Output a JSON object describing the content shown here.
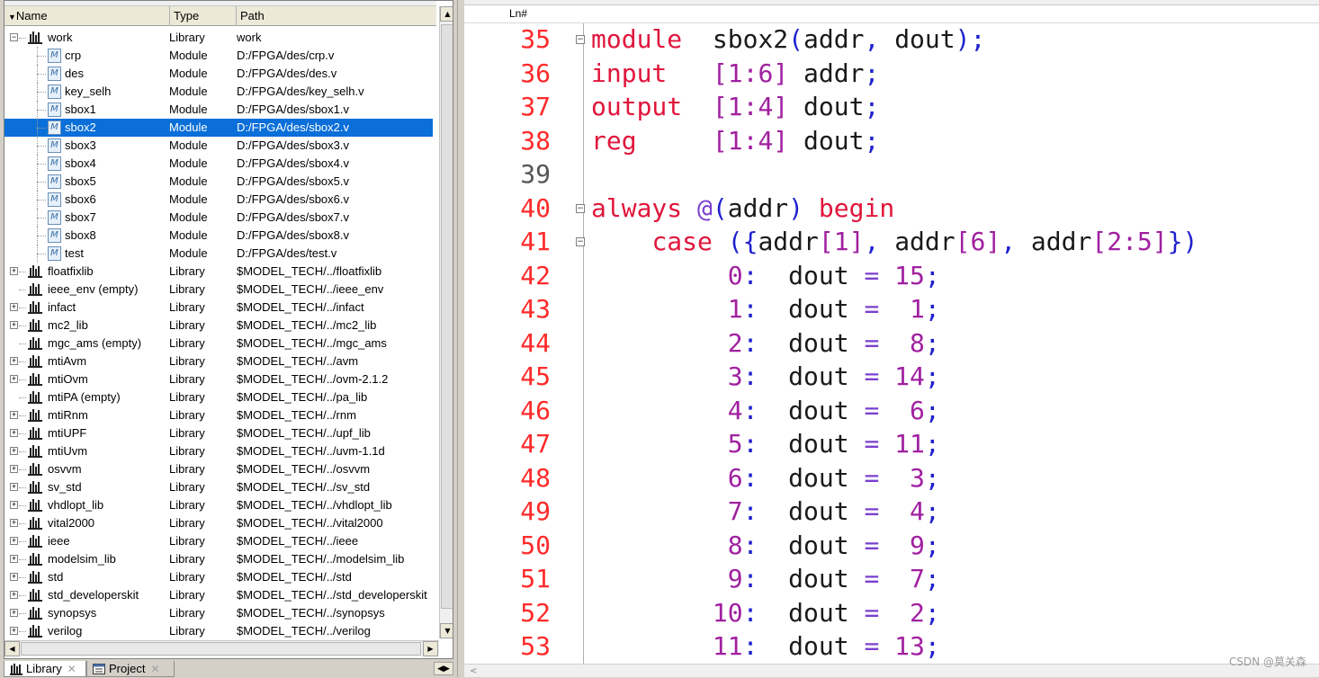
{
  "library": {
    "columns": {
      "name": "Name",
      "type": "Type",
      "path": "Path"
    },
    "rows": [
      {
        "name": "work",
        "type": "Library",
        "path": "work",
        "kind": "lib",
        "expander": "−",
        "level": 0
      },
      {
        "name": "crp",
        "type": "Module",
        "path": "D:/FPGA/des/crp.v",
        "kind": "mod",
        "level": 1
      },
      {
        "name": "des",
        "type": "Module",
        "path": "D:/FPGA/des/des.v",
        "kind": "mod",
        "level": 1
      },
      {
        "name": "key_selh",
        "type": "Module",
        "path": "D:/FPGA/des/key_selh.v",
        "kind": "mod",
        "level": 1
      },
      {
        "name": "sbox1",
        "type": "Module",
        "path": "D:/FPGA/des/sbox1.v",
        "kind": "mod",
        "level": 1
      },
      {
        "name": "sbox2",
        "type": "Module",
        "path": "D:/FPGA/des/sbox2.v",
        "kind": "mod",
        "level": 1,
        "selected": true
      },
      {
        "name": "sbox3",
        "type": "Module",
        "path": "D:/FPGA/des/sbox3.v",
        "kind": "mod",
        "level": 1
      },
      {
        "name": "sbox4",
        "type": "Module",
        "path": "D:/FPGA/des/sbox4.v",
        "kind": "mod",
        "level": 1
      },
      {
        "name": "sbox5",
        "type": "Module",
        "path": "D:/FPGA/des/sbox5.v",
        "kind": "mod",
        "level": 1
      },
      {
        "name": "sbox6",
        "type": "Module",
        "path": "D:/FPGA/des/sbox6.v",
        "kind": "mod",
        "level": 1
      },
      {
        "name": "sbox7",
        "type": "Module",
        "path": "D:/FPGA/des/sbox7.v",
        "kind": "mod",
        "level": 1
      },
      {
        "name": "sbox8",
        "type": "Module",
        "path": "D:/FPGA/des/sbox8.v",
        "kind": "mod",
        "level": 1
      },
      {
        "name": "test",
        "type": "Module",
        "path": "D:/FPGA/des/test.v",
        "kind": "mod",
        "level": 1
      },
      {
        "name": "floatfixlib",
        "type": "Library",
        "path": "$MODEL_TECH/../floatfixlib",
        "kind": "lib",
        "expander": "+",
        "level": 0
      },
      {
        "name": "ieee_env  (empty)",
        "type": "Library",
        "path": "$MODEL_TECH/../ieee_env",
        "kind": "lib",
        "level": 0
      },
      {
        "name": "infact",
        "type": "Library",
        "path": "$MODEL_TECH/../infact",
        "kind": "lib",
        "expander": "+",
        "level": 0
      },
      {
        "name": "mc2_lib",
        "type": "Library",
        "path": "$MODEL_TECH/../mc2_lib",
        "kind": "lib",
        "expander": "+",
        "level": 0
      },
      {
        "name": "mgc_ams  (empty)",
        "type": "Library",
        "path": "$MODEL_TECH/../mgc_ams",
        "kind": "lib",
        "level": 0
      },
      {
        "name": "mtiAvm",
        "type": "Library",
        "path": "$MODEL_TECH/../avm",
        "kind": "lib",
        "expander": "+",
        "level": 0
      },
      {
        "name": "mtiOvm",
        "type": "Library",
        "path": "$MODEL_TECH/../ovm-2.1.2",
        "kind": "lib",
        "expander": "+",
        "level": 0
      },
      {
        "name": "mtiPA  (empty)",
        "type": "Library",
        "path": "$MODEL_TECH/../pa_lib",
        "kind": "lib",
        "level": 0
      },
      {
        "name": "mtiRnm",
        "type": "Library",
        "path": "$MODEL_TECH/../rnm",
        "kind": "lib",
        "expander": "+",
        "level": 0
      },
      {
        "name": "mtiUPF",
        "type": "Library",
        "path": "$MODEL_TECH/../upf_lib",
        "kind": "lib",
        "expander": "+",
        "level": 0
      },
      {
        "name": "mtiUvm",
        "type": "Library",
        "path": "$MODEL_TECH/../uvm-1.1d",
        "kind": "lib",
        "expander": "+",
        "level": 0
      },
      {
        "name": "osvvm",
        "type": "Library",
        "path": "$MODEL_TECH/../osvvm",
        "kind": "lib",
        "expander": "+",
        "level": 0
      },
      {
        "name": "sv_std",
        "type": "Library",
        "path": "$MODEL_TECH/../sv_std",
        "kind": "lib",
        "expander": "+",
        "level": 0
      },
      {
        "name": "vhdlopt_lib",
        "type": "Library",
        "path": "$MODEL_TECH/../vhdlopt_lib",
        "kind": "lib",
        "expander": "+",
        "level": 0
      },
      {
        "name": "vital2000",
        "type": "Library",
        "path": "$MODEL_TECH/../vital2000",
        "kind": "lib",
        "expander": "+",
        "level": 0
      },
      {
        "name": "ieee",
        "type": "Library",
        "path": "$MODEL_TECH/../ieee",
        "kind": "lib",
        "expander": "+",
        "level": 0
      },
      {
        "name": "modelsim_lib",
        "type": "Library",
        "path": "$MODEL_TECH/../modelsim_lib",
        "kind": "lib",
        "expander": "+",
        "level": 0
      },
      {
        "name": "std",
        "type": "Library",
        "path": "$MODEL_TECH/../std",
        "kind": "lib",
        "expander": "+",
        "level": 0
      },
      {
        "name": "std_developerskit",
        "type": "Library",
        "path": "$MODEL_TECH/../std_developerskit",
        "kind": "lib",
        "expander": "+",
        "level": 0
      },
      {
        "name": "synopsys",
        "type": "Library",
        "path": "$MODEL_TECH/../synopsys",
        "kind": "lib",
        "expander": "+",
        "level": 0
      },
      {
        "name": "verilog",
        "type": "Library",
        "path": "$MODEL_TECH/../verilog",
        "kind": "lib",
        "expander": "+",
        "level": 0
      }
    ]
  },
  "tabs": [
    {
      "label": "Library",
      "icon": "library-icon",
      "active": true
    },
    {
      "label": "Project",
      "icon": "project-icon",
      "active": false
    }
  ],
  "editor": {
    "ln_label": "Ln#",
    "lines": [
      {
        "no": "35",
        "fold": "−",
        "tokens": [
          [
            "kw",
            "module"
          ],
          [
            "id",
            "  sbox2"
          ],
          [
            "pu",
            "("
          ],
          [
            "id",
            "addr"
          ],
          [
            "pu",
            ", "
          ],
          [
            "id",
            "dout"
          ],
          [
            "pu",
            ");"
          ]
        ]
      },
      {
        "no": "36",
        "tokens": [
          [
            "kw",
            "input"
          ],
          [
            "id",
            "   "
          ],
          [
            "nu",
            "[1:6]"
          ],
          [
            "id",
            " addr"
          ],
          [
            "pu",
            ";"
          ]
        ]
      },
      {
        "no": "37",
        "tokens": [
          [
            "kw",
            "output"
          ],
          [
            "id",
            "  "
          ],
          [
            "nu",
            "[1:4]"
          ],
          [
            "id",
            " dout"
          ],
          [
            "pu",
            ";"
          ]
        ]
      },
      {
        "no": "38",
        "tokens": [
          [
            "kw",
            "reg"
          ],
          [
            "id",
            "     "
          ],
          [
            "nu",
            "[1:4]"
          ],
          [
            "id",
            " dout"
          ],
          [
            "pu",
            ";"
          ]
        ]
      },
      {
        "no": "39",
        "dim": true,
        "tokens": []
      },
      {
        "no": "40",
        "fold": "−",
        "tokens": [
          [
            "kw",
            "always"
          ],
          [
            "id",
            " "
          ],
          [
            "op",
            "@"
          ],
          [
            "pu",
            "("
          ],
          [
            "id",
            "addr"
          ],
          [
            "pu",
            ")"
          ],
          [
            "id",
            " "
          ],
          [
            "kw",
            "begin"
          ]
        ]
      },
      {
        "no": "41",
        "fold": "−",
        "tokens": [
          [
            "id",
            "    "
          ],
          [
            "kw",
            "case"
          ],
          [
            "id",
            " "
          ],
          [
            "pu",
            "({"
          ],
          [
            "id",
            "addr"
          ],
          [
            "nu",
            "[1]"
          ],
          [
            "pu",
            ", "
          ],
          [
            "id",
            "addr"
          ],
          [
            "nu",
            "[6]"
          ],
          [
            "pu",
            ", "
          ],
          [
            "id",
            "addr"
          ],
          [
            "nu",
            "[2:5]"
          ],
          [
            "pu",
            "})"
          ]
        ]
      },
      {
        "no": "42",
        "tokens": [
          [
            "nu",
            "         0"
          ],
          [
            "pu",
            ":"
          ],
          [
            "id",
            "  dout "
          ],
          [
            "op",
            "="
          ],
          [
            "nu",
            " 15"
          ],
          [
            "pu",
            ";"
          ]
        ]
      },
      {
        "no": "43",
        "tokens": [
          [
            "nu",
            "         1"
          ],
          [
            "pu",
            ":"
          ],
          [
            "id",
            "  dout "
          ],
          [
            "op",
            "="
          ],
          [
            "nu",
            "  1"
          ],
          [
            "pu",
            ";"
          ]
        ]
      },
      {
        "no": "44",
        "tokens": [
          [
            "nu",
            "         2"
          ],
          [
            "pu",
            ":"
          ],
          [
            "id",
            "  dout "
          ],
          [
            "op",
            "="
          ],
          [
            "nu",
            "  8"
          ],
          [
            "pu",
            ";"
          ]
        ]
      },
      {
        "no": "45",
        "tokens": [
          [
            "nu",
            "         3"
          ],
          [
            "pu",
            ":"
          ],
          [
            "id",
            "  dout "
          ],
          [
            "op",
            "="
          ],
          [
            "nu",
            " 14"
          ],
          [
            "pu",
            ";"
          ]
        ]
      },
      {
        "no": "46",
        "tokens": [
          [
            "nu",
            "         4"
          ],
          [
            "pu",
            ":"
          ],
          [
            "id",
            "  dout "
          ],
          [
            "op",
            "="
          ],
          [
            "nu",
            "  6"
          ],
          [
            "pu",
            ";"
          ]
        ]
      },
      {
        "no": "47",
        "tokens": [
          [
            "nu",
            "         5"
          ],
          [
            "pu",
            ":"
          ],
          [
            "id",
            "  dout "
          ],
          [
            "op",
            "="
          ],
          [
            "nu",
            " 11"
          ],
          [
            "pu",
            ";"
          ]
        ]
      },
      {
        "no": "48",
        "tokens": [
          [
            "nu",
            "         6"
          ],
          [
            "pu",
            ":"
          ],
          [
            "id",
            "  dout "
          ],
          [
            "op",
            "="
          ],
          [
            "nu",
            "  3"
          ],
          [
            "pu",
            ";"
          ]
        ]
      },
      {
        "no": "49",
        "tokens": [
          [
            "nu",
            "         7"
          ],
          [
            "pu",
            ":"
          ],
          [
            "id",
            "  dout "
          ],
          [
            "op",
            "="
          ],
          [
            "nu",
            "  4"
          ],
          [
            "pu",
            ";"
          ]
        ]
      },
      {
        "no": "50",
        "tokens": [
          [
            "nu",
            "         8"
          ],
          [
            "pu",
            ":"
          ],
          [
            "id",
            "  dout "
          ],
          [
            "op",
            "="
          ],
          [
            "nu",
            "  9"
          ],
          [
            "pu",
            ";"
          ]
        ]
      },
      {
        "no": "51",
        "tokens": [
          [
            "nu",
            "         9"
          ],
          [
            "pu",
            ":"
          ],
          [
            "id",
            "  dout "
          ],
          [
            "op",
            "="
          ],
          [
            "nu",
            "  7"
          ],
          [
            "pu",
            ";"
          ]
        ]
      },
      {
        "no": "52",
        "tokens": [
          [
            "nu",
            "        10"
          ],
          [
            "pu",
            ":"
          ],
          [
            "id",
            "  dout "
          ],
          [
            "op",
            "="
          ],
          [
            "nu",
            "  2"
          ],
          [
            "pu",
            ";"
          ]
        ]
      },
      {
        "no": "53",
        "tokens": [
          [
            "nu",
            "        11"
          ],
          [
            "pu",
            ":"
          ],
          [
            "id",
            "  dout "
          ],
          [
            "op",
            "="
          ],
          [
            "nu",
            " 13"
          ],
          [
            "pu",
            ";"
          ]
        ]
      }
    ]
  },
  "watermark": "CSDN @莫关森",
  "colors": {
    "selection": "#0a6fd8",
    "keyword": "#e0163c",
    "number": "#a020a0",
    "line_number": "#ff2a2a"
  }
}
